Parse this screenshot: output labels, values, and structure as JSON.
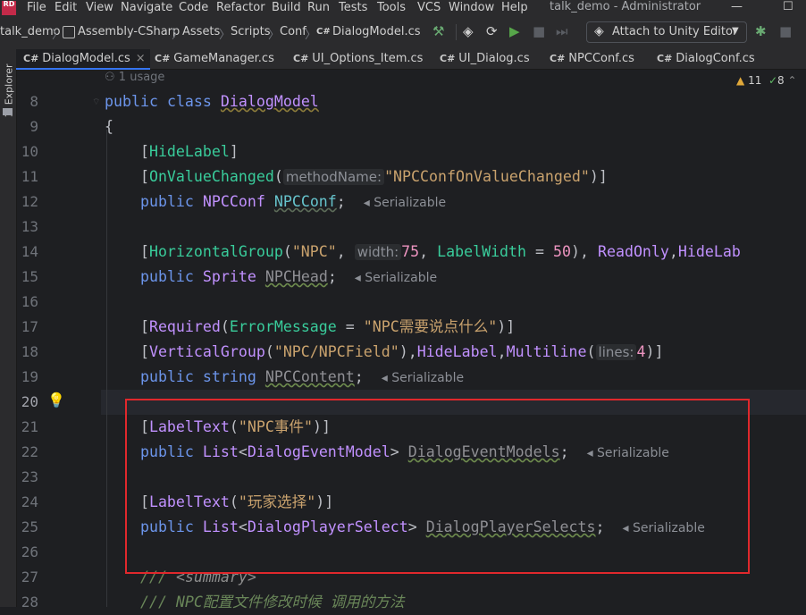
{
  "menubar": {
    "logo": "RD",
    "items": [
      "File",
      "Edit",
      "View",
      "Navigate",
      "Code",
      "Refactor",
      "Build",
      "Run",
      "Tests",
      "Tools",
      "VCS",
      "Window",
      "Help"
    ],
    "title": "talk_demo - Administrator",
    "min": "—",
    "max": "☐"
  },
  "breadcrumb": {
    "items": [
      "talk_demo",
      "Assembly-CSharp",
      "Assets",
      "Scripts",
      "Conf",
      "DialogModel.cs"
    ],
    "cs_badge": "C#",
    "attach_label": "Attach to Unity Editor"
  },
  "tabs": [
    {
      "label": "DialogModel.cs",
      "active": true
    },
    {
      "label": "GameManager.cs"
    },
    {
      "label": "UI_Options_Item.cs"
    },
    {
      "label": "UI_Dialog.cs"
    },
    {
      "label": "NPCConf.cs"
    },
    {
      "label": "DialogConf.cs"
    }
  ],
  "cs_prefix": "C#",
  "left_panel": "1: Explorer",
  "editor": {
    "usage": "1 usage",
    "warnings": "11",
    "checks": "8",
    "line_numbers": [
      "8",
      "9",
      "10",
      "11",
      "12",
      "13",
      "14",
      "15",
      "16",
      "17",
      "18",
      "19",
      "20",
      "21",
      "22",
      "23",
      "24",
      "25",
      "26",
      "27",
      "28"
    ],
    "serializable": "Serializable",
    "lines": {
      "l8_kw1": "public",
      "l8_kw2": "class",
      "l8_name": "DialogModel",
      "l9": "{",
      "l10_attr": "HideLabel",
      "l11_attr": "OnValueChanged",
      "l11_hint": "methodName:",
      "l11_str": "\"NPCConfOnValueChanged\"",
      "l12_kw": "public",
      "l12_type": "NPCConf",
      "l12_field": "NPCConf",
      "l14_attr1": "HorizontalGroup",
      "l14_str": "\"NPC\"",
      "l14_hint": "width:",
      "l14_num": "75",
      "l14_attr2": "LabelWidth",
      "l14_num2": "50",
      "l14_attr3": "ReadOnly",
      "l14_attr4": "HideLab",
      "l15_kw": "public",
      "l15_type": "Sprite",
      "l15_field": "NPCHead",
      "l17_attr": "Required",
      "l17_param": "ErrorMessage",
      "l17_str": "\"NPC需要说点什么\"",
      "l18_attr1": "VerticalGroup",
      "l18_str": "\"NPC/NPCField\"",
      "l18_attr2": "HideLabel",
      "l18_attr3": "Multiline",
      "l18_hint": "lines:",
      "l18_num": "4",
      "l19_kw": "public",
      "l19_type": "string",
      "l19_field": "NPCContent",
      "l21_attr": "LabelText",
      "l21_str": "\"NPC事件\"",
      "l22_kw": "public",
      "l22_type": "List",
      "l22_arg": "DialogEventModel",
      "l22_field": "DialogEventModels",
      "l24_attr": "LabelText",
      "l24_str": "\"玩家选择\"",
      "l25_kw": "public",
      "l25_type": "List",
      "l25_arg": "DialogPlayerSelect",
      "l25_field": "DialogPlayerSelects",
      "l27_c1": "///",
      "l27_tag": "<summary>",
      "l28_c": "/// NPC配置文件修改时候 调用的方法"
    }
  }
}
